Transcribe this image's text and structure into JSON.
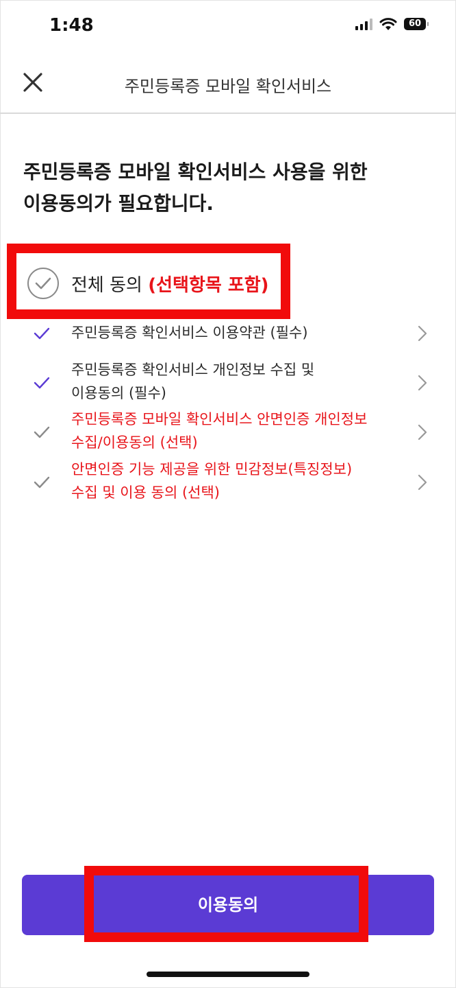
{
  "status_bar": {
    "time": "1:48",
    "battery": "60"
  },
  "header": {
    "title": "주민등록증 모바일 확인서비스"
  },
  "main": {
    "heading": "주민등록증 모바일 확인서비스 사용을 위한\n이용동의가 필요합니다."
  },
  "agree_all": {
    "label": "전체 동의",
    "option_note": "(선택항목 포함)"
  },
  "terms": [
    {
      "text": "주민등록증 확인서비스 이용약관 (필수)"
    },
    {
      "text": "주민등록증 확인서비스 개인정보 수집 및\n이용동의 (필수)"
    },
    {
      "text": "주민등록증 모바일 확인서비스 안면인증 개인정보\n수집/이용동의 (선택)"
    },
    {
      "text": "안면인증 기능 제공을 위한 민감정보(특징정보)\n수집 및 이용 동의 (선택)"
    }
  ],
  "footer": {
    "button_label": "이용동의"
  },
  "colors": {
    "accent": "#5b3bd4",
    "highlight": "#f10b0b",
    "optional_text": "#e8141a",
    "required_check": "#5b3bd4",
    "optional_check": "#8a8a8a"
  }
}
